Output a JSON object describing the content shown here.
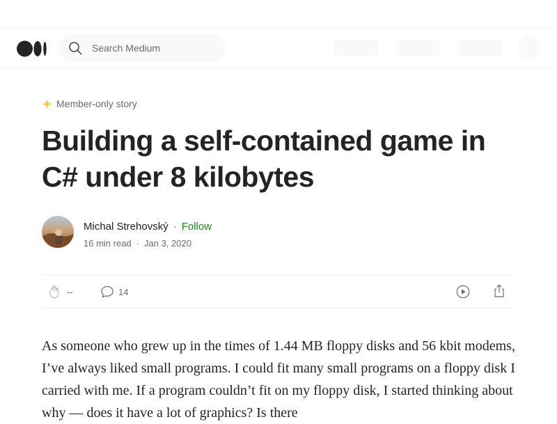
{
  "search": {
    "placeholder": "Search Medium"
  },
  "article": {
    "member_label": "Member-only story",
    "title": "Building a self-contained game in C# under 8 kilobytes",
    "author": {
      "name": "Michal Strehovský",
      "follow_label": "Follow",
      "read_time": "16 min read",
      "date": "Jan 3, 2020"
    },
    "actions": {
      "clap_count": "--",
      "response_count": "14"
    },
    "body": "As someone who grew up in the times of 1.44 MB floppy disks and 56 kbit modems, I’ve always liked small programs. I could fit many small programs on a floppy disk I carried with me. If a program couldn’t fit on my floppy disk, I started thinking about why — does it have a lot of graphics? Is there"
  },
  "colors": {
    "accent_star": "#ffc017",
    "follow_green": "#1a8917",
    "muted_text": "#6b6b6b",
    "primary_text": "#242424"
  },
  "icons": [
    "medium-logo-icon",
    "search-icon",
    "star-icon",
    "clap-icon",
    "response-icon",
    "listen-icon",
    "share-icon"
  ]
}
